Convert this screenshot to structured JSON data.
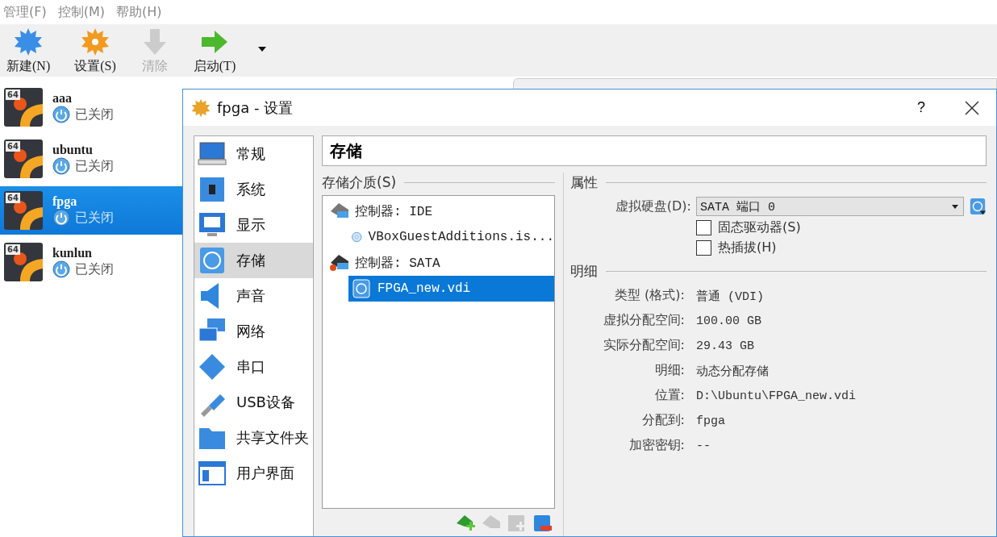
{
  "menu": [
    {
      "label": "管理(F)"
    },
    {
      "label": "控制(M)"
    },
    {
      "label": "帮助(H)"
    }
  ],
  "toolbar": [
    {
      "label": "新建(N)",
      "kind": "new",
      "disabled": false
    },
    {
      "label": "设置(S)",
      "kind": "settings",
      "disabled": false
    },
    {
      "label": "清除",
      "kind": "discard",
      "disabled": true
    },
    {
      "label": "启动(T)",
      "kind": "start",
      "disabled": false
    }
  ],
  "vms": [
    {
      "name": "aaa",
      "badge": "64",
      "state": "已关闭",
      "selected": false
    },
    {
      "name": "ubuntu",
      "badge": "64",
      "state": "已关闭",
      "selected": false
    },
    {
      "name": "fpga",
      "badge": "64",
      "state": "已关闭",
      "selected": true
    },
    {
      "name": "kunlun",
      "badge": "64",
      "state": "已关闭",
      "selected": false
    }
  ],
  "dialog": {
    "title": "fpga - 设置",
    "help": "?",
    "nav": [
      {
        "label": "常规",
        "kind": "general",
        "selected": false
      },
      {
        "label": "系统",
        "kind": "system",
        "selected": false
      },
      {
        "label": "显示",
        "kind": "display",
        "selected": false
      },
      {
        "label": "存储",
        "kind": "storage",
        "selected": true
      },
      {
        "label": "声音",
        "kind": "audio",
        "selected": false
      },
      {
        "label": "网络",
        "kind": "network",
        "selected": false
      },
      {
        "label": "串口",
        "kind": "serial",
        "selected": false
      },
      {
        "label": "USB设备",
        "kind": "usb",
        "selected": false
      },
      {
        "label": "共享文件夹",
        "kind": "shared",
        "selected": false
      },
      {
        "label": "用户界面",
        "kind": "ui",
        "selected": false
      }
    ],
    "page_title": "存储",
    "storage": {
      "label": "存储介质(S)",
      "tree": [
        {
          "label": "控制器: IDE",
          "kind": "ide",
          "selected": false,
          "children": [
            {
              "label": "VBoxGuestAdditions.is...",
              "kind": "optical",
              "selected": false
            }
          ]
        },
        {
          "label": "控制器: SATA",
          "kind": "sata",
          "selected": false,
          "children": [
            {
              "label": "FPGA_new.vdi",
              "kind": "disk",
              "selected": true
            }
          ]
        }
      ],
      "buttons": [
        {
          "kind": "add-controller",
          "disabled": false
        },
        {
          "kind": "remove-controller",
          "disabled": true
        },
        {
          "kind": "add-attachment",
          "disabled": true
        },
        {
          "kind": "remove-attachment",
          "disabled": false
        }
      ]
    },
    "attributes": {
      "heading": "属性",
      "disk_label": "虚拟硬盘(D):",
      "disk_value": "SATA 端口 0",
      "checkboxes": [
        {
          "label": "固态驱动器(S)",
          "checked": false
        },
        {
          "label": "热插拔(H)",
          "checked": false
        }
      ]
    },
    "details": {
      "heading": "明细",
      "rows": [
        {
          "label": "类型 (格式):",
          "value": "普通 (VDI)"
        },
        {
          "label": "虚拟分配空间:",
          "value": "100.00 GB"
        },
        {
          "label": "实际分配空间:",
          "value": "29.43 GB"
        },
        {
          "label": "明细:",
          "value": "动态分配存储"
        },
        {
          "label": "位置:",
          "value": "D:\\Ubuntu\\FPGA_new.vdi"
        },
        {
          "label": "分配到:",
          "value": "fpga"
        },
        {
          "label": "加密密钥:",
          "value": "--"
        }
      ]
    }
  }
}
